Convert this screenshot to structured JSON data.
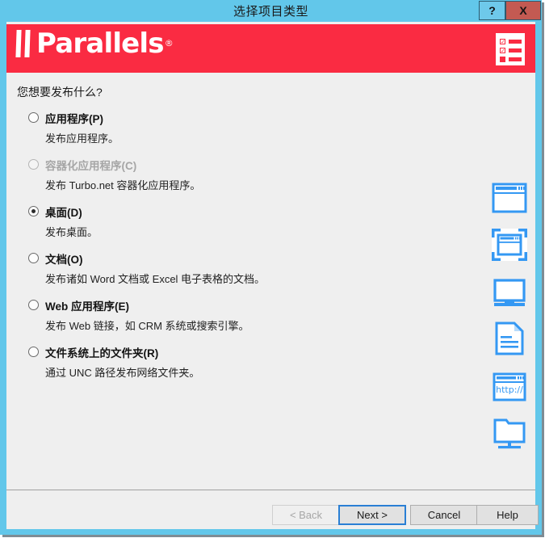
{
  "window": {
    "title": "选择项目类型",
    "help_button": "?",
    "close_button": "X",
    "titlebar_color": "#62c7ea",
    "close_color": "#c35a52"
  },
  "banner": {
    "brand": "Parallels",
    "registered_mark": "®",
    "background_color": "#fa2b42",
    "icon": "checklist-icon"
  },
  "content": {
    "question": "您想要发布什么?",
    "accent_color": "#3498f3",
    "options": [
      {
        "label": "应用程序(P)",
        "description": "发布应用程序。",
        "selected": false,
        "disabled": false,
        "icon": "application-window-icon"
      },
      {
        "label": "容器化应用程序(C)",
        "description": "发布 Turbo.net 容器化应用程序。",
        "selected": false,
        "disabled": true,
        "icon": "containerized-application-icon"
      },
      {
        "label": "桌面(D)",
        "description": "发布桌面。",
        "selected": true,
        "disabled": false,
        "icon": "desktop-monitor-icon"
      },
      {
        "label": "文档(O)",
        "description": "发布诸如 Word 文档或 Excel 电子表格的文档。",
        "selected": false,
        "disabled": false,
        "icon": "document-icon"
      },
      {
        "label": "Web 应用程序(E)",
        "description": "发布 Web 链接，如 CRM 系统或搜索引擎。",
        "selected": false,
        "disabled": false,
        "icon": "web-browser-icon",
        "icon_text": "http://"
      },
      {
        "label": "文件系统上的文件夹(R)",
        "description": "通过 UNC 路径发布网络文件夹。",
        "selected": false,
        "disabled": false,
        "icon": "network-folder-icon"
      }
    ]
  },
  "footer": {
    "back_label": "< Back",
    "next_label": "Next >",
    "cancel_label": "Cancel",
    "help_label": "Help"
  }
}
